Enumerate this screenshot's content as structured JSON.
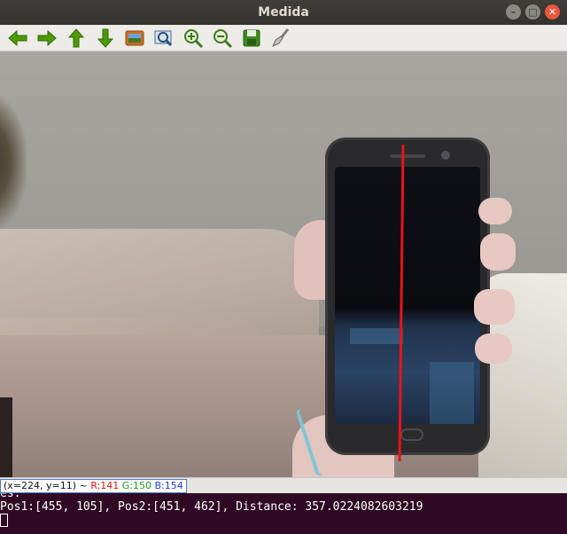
{
  "window": {
    "title": "Medida",
    "controls": {
      "minimize": "–",
      "maximize": "□",
      "close": "✕"
    }
  },
  "toolbar": {
    "buttons": [
      {
        "name": "pan-left",
        "icon": "arrow-left-icon"
      },
      {
        "name": "pan-right",
        "icon": "arrow-right-icon"
      },
      {
        "name": "pan-up",
        "icon": "arrow-up-icon"
      },
      {
        "name": "pan-down",
        "icon": "arrow-down-icon"
      },
      {
        "name": "zoom-reset",
        "icon": "image-icon"
      },
      {
        "name": "zoom-fit",
        "icon": "zoom-fit-icon"
      },
      {
        "name": "zoom-in",
        "icon": "zoom-in-icon"
      },
      {
        "name": "zoom-out",
        "icon": "zoom-out-icon"
      },
      {
        "name": "save",
        "icon": "save-icon"
      },
      {
        "name": "properties",
        "icon": "brush-icon"
      }
    ]
  },
  "image": {
    "measure_line_color": "#e8131a"
  },
  "status": {
    "coords": "(x=224, y=11) ~ ",
    "r": "R:141",
    "g": "G:150",
    "b": "B:154"
  },
  "terminal": {
    "partial_line": "es:",
    "output_line": "Pos1:[455, 105], Pos2:[451, 462], Distance: 357.0224082603219"
  },
  "colors": {
    "titlebar": "#3b3a36",
    "terminal_bg": "#300a24",
    "arrow_green": "#4e9a06"
  }
}
